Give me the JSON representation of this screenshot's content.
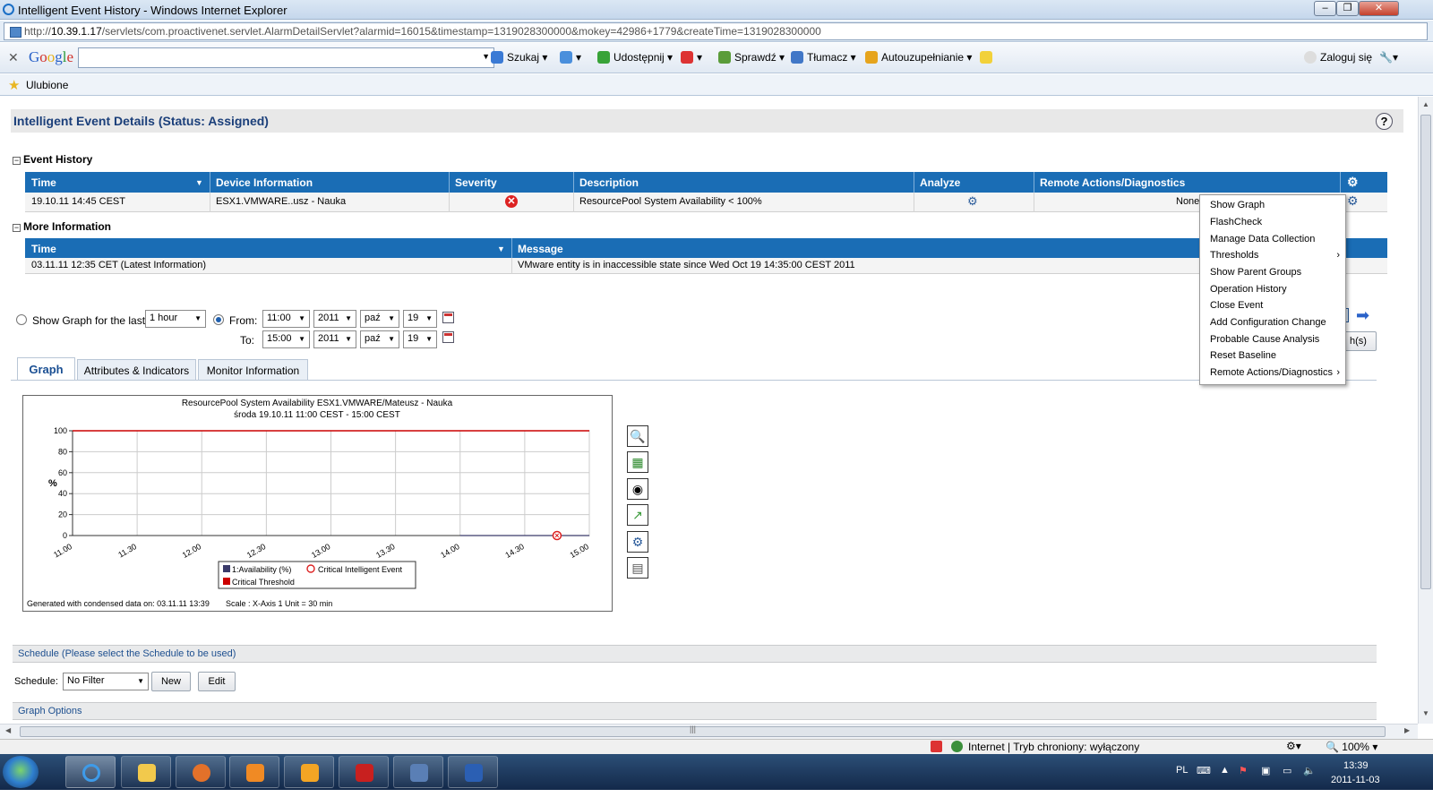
{
  "window": {
    "title": "Intelligent Event History - Windows Internet Explorer"
  },
  "address": {
    "prefix": "http://",
    "host": "10.39.1.17",
    "path": "/servlets/com.proactivenet.servlet.AlarmDetailServlet?alarmid=16015&timestamp=1319028300000&mokey=42986+1779&createTime=1319028300000"
  },
  "google_toolbar": {
    "logo": "Google",
    "search_value": "",
    "items": [
      "Szukaj",
      "Udostępnij",
      "Sprawdź",
      "Tłumacz",
      "Autouzupełnianie",
      "Zaloguj się"
    ]
  },
  "favorites": {
    "label": "Ulubione"
  },
  "page": {
    "title": "Intelligent Event Details (Status: Assigned)",
    "help": "?",
    "event_history": {
      "heading": "Event History",
      "columns": [
        "Time",
        "Device Information",
        "Severity",
        "Description",
        "Analyze",
        "Remote Actions/Diagnostics"
      ],
      "row": {
        "time": "19.10.11 14:45 CEST",
        "device": "ESX1.VMWARE..usz - Nauka",
        "description": "ResourcePool System Availability < 100%",
        "remote": "None"
      }
    },
    "more_info": {
      "heading": "More Information",
      "columns": [
        "Time",
        "Message"
      ],
      "row": {
        "time": "03.11.11 12:35 CET (Latest Information)",
        "message": "VMware entity is in inaccessible state since Wed Oct 19 14:35:00 CEST 2011"
      }
    },
    "range": {
      "show_last_label": "Show Graph for the last:",
      "last_value": "1 hour",
      "from_label": "From:",
      "to_label": "To:",
      "from": {
        "time": "11:00",
        "year": "2011",
        "month": "paź",
        "day": "19"
      },
      "to": {
        "time": "15:00",
        "year": "2011",
        "month": "paź",
        "day": "19"
      },
      "graph_button_fragment": "h(s)"
    },
    "tabs": [
      "Graph",
      "Attributes & Indicators",
      "Monitor Information"
    ],
    "chart_footer": "Generated with condensed data on: 03.11.11 13:39",
    "chart_scale": "Scale : X-Axis 1 Unit = 30 min",
    "schedule": {
      "bar_label": "Schedule (Please select the Schedule to be used)",
      "label": "Schedule:",
      "value": "No Filter",
      "new_button": "New",
      "edit_button": "Edit"
    },
    "graph_options": "Graph Options"
  },
  "context_menu": {
    "items": [
      "Show Graph",
      "FlashCheck",
      "Manage Data Collection",
      "Thresholds",
      "Show Parent Groups",
      "Operation History",
      "Close Event",
      "Add Configuration Change",
      "Probable Cause Analysis",
      "Reset Baseline",
      "Remote Actions/Diagnostics"
    ]
  },
  "status_bar": {
    "zone": "Internet | Tryb chroniony: wyłączony",
    "zoom": "100%"
  },
  "taskbar": {
    "lang": "PL",
    "time": "13:39",
    "date": "2011-11-03"
  },
  "chart_data": {
    "type": "line",
    "title": "ResourcePool System Availability ESX1.VMWARE/Mateusz - Nauka",
    "subtitle": "środa 19.10.11 11:00 CEST - 15:00 CEST",
    "ylabel": "%",
    "xlabel": "",
    "ylim": [
      0,
      100
    ],
    "yticks": [
      0,
      20,
      40,
      60,
      80,
      100
    ],
    "categories": [
      "11:00",
      "11:30",
      "12:00",
      "12:30",
      "13:00",
      "13:30",
      "14:00",
      "14:30",
      "15:00"
    ],
    "series": [
      {
        "name": "1:Availability (%)",
        "color": "#3a3a6a",
        "points": [
          [
            "14:00",
            0
          ],
          [
            "14:30",
            0
          ],
          [
            "14:45",
            0
          ],
          [
            "15:00",
            0
          ]
        ]
      },
      {
        "name": "Critical Threshold",
        "color": "#cc0000",
        "points": [
          [
            "11:00",
            100
          ],
          [
            "15:00",
            100
          ]
        ]
      }
    ],
    "events": [
      {
        "name": "Critical Intelligent Event",
        "x": "14:45",
        "y": 0
      }
    ],
    "legend": [
      "1:Availability (%)",
      "Critical Intelligent Event",
      "Critical Threshold"
    ],
    "grid": true,
    "legend_position": "bottom"
  }
}
